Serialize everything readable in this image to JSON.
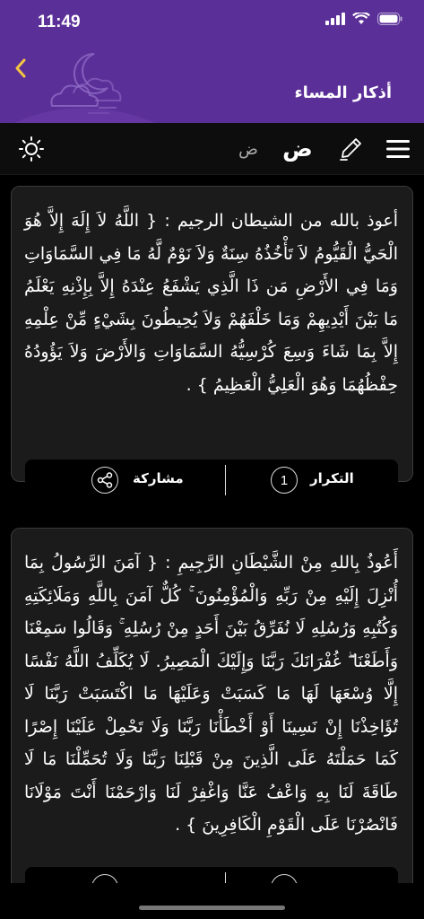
{
  "status_bar": {
    "time": "11:49"
  },
  "header": {
    "title": "أذكار المساء",
    "back_icon": "chevron-left-icon",
    "background_color": "#5b2f98"
  },
  "toolbar": {
    "menu_icon": "hamburger-icon",
    "edit_icon": "pen-icon",
    "font_large": "ض",
    "font_small": "ض",
    "theme_icon": "sun-icon"
  },
  "cards": [
    {
      "text": "أعوذ بالله من الشيطان الرجيم : { اللَّهُ لاَ إِلَهَ إِلاَّ هُوَ الْحَيُّ الْقَيُّومُ لاَ تَأْخُذُهُ سِنَةٌ وَلاَ نَوْمٌ لَّهُ مَا فِي السَّمَاوَاتِ وَمَا فِي الأَرْضِ مَن ذَا الَّذِي يَشْفَعُ عِنْدَهُ إِلاَّ بِإِذْنِهِ يَعْلَمُ مَا بَيْنَ أَيْدِيهِمْ وَمَا خَلْفَهُمْ وَلاَ يُحِيطُونَ بِشَيْءٍ مِّنْ عِلْمِهِ إِلاَّ بِمَا شَاءَ وَسِعَ كُرْسِيُّهُ السَّمَاوَاتِ وَالأَرْضَ وَلاَ يَؤُودُهُ حِفْظُهُمَا وَهُوَ الْعَلِيُّ الْعَظِيمُ } .",
      "repeat_label": "التكرار",
      "repeat_count": "1",
      "share_label": "مشاركة"
    },
    {
      "text": "أَعُوذُ بِاللهِ مِنْ الشَّيْطَانِ الرَّجِيمِ : { آمَنَ الرَّسُولُ بِمَا أُنْزِلَ إِلَيْهِ مِنْ رَبِّهِ وَالْمُؤْمِنُونَ ۚ كُلٌّ آمَنَ بِاللَّهِ وَمَلَائِكَتِهِ وَكُتُبِهِ وَرُسُلِهِ لَا نُفَرِّقُ بَيْنَ أَحَدٍ مِنْ رُسُلِهِ ۚ وَقَالُوا سَمِعْنَا وَأَطَعْنَا ۖ غُفْرَانَكَ رَبَّنَا وَإِلَيْكَ الْمَصِيرُ. لَا يُكَلِّفُ اللَّهُ نَفْسًا إِلَّا وُسْعَهَا لَهَا مَا كَسَبَتْ وَعَلَيْهَا مَا اكْتَسَبَتْ رَبَّنَا لَا تُؤَاخِذْنَا إِنْ نَسِينَا أَوْ أَخْطَأْنَا رَبَّنَا وَلَا تَحْمِلْ عَلَيْنَا إِصْرًا كَمَا حَمَلْتَهُ عَلَى الَّذِينَ مِنْ قَبْلِنَا رَبَّنَا وَلَا تُحَمِّلْنَا مَا لَا طَاقَةَ لَنَا بِهِ وَاعْفُ عَنَّا وَاغْفِرْ لَنَا وَارْحَمْنَا أَنْتَ مَوْلَانَا فَانْصُرْنَا عَلَى الْقَوْمِ الْكَافِرِينَ } ."
    }
  ]
}
